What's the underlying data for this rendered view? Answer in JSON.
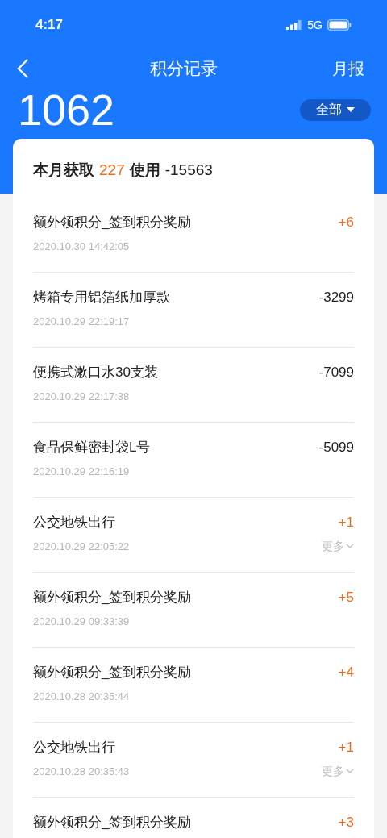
{
  "status_bar": {
    "time": "4:17",
    "network": "5G"
  },
  "nav": {
    "title": "积分记录",
    "action": "月报"
  },
  "balance": "1062",
  "filter": {
    "label": "全部"
  },
  "summary": [
    {
      "kind": "label",
      "text": "本月获取"
    },
    {
      "kind": "gain",
      "text": "227"
    },
    {
      "kind": "label",
      "text": "使用"
    },
    {
      "kind": "value",
      "text": "-15563"
    }
  ],
  "records": [
    {
      "name": "额外领积分_签到积分奖励",
      "date": "2020.10.30 14:42:05",
      "amount": "+6",
      "kind": "gain"
    },
    {
      "name": "烤箱专用铝箔纸加厚款",
      "date": "2020.10.29 22:19:17",
      "amount": "-3299",
      "kind": "spend"
    },
    {
      "name": "便携式漱口水30支装",
      "date": "2020.10.29 22:17:38",
      "amount": "-7099",
      "kind": "spend"
    },
    {
      "name": "食品保鲜密封袋L号",
      "date": "2020.10.29 22:16:19",
      "amount": "-5099",
      "kind": "spend"
    },
    {
      "name": "公交地铁出行",
      "date": "2020.10.29 22:05:22",
      "amount": "+1",
      "kind": "gain",
      "more": "更多"
    },
    {
      "name": "额外领积分_签到积分奖励",
      "date": "2020.10.29 09:33:39",
      "amount": "+5",
      "kind": "gain"
    },
    {
      "name": "额外领积分_签到积分奖励",
      "date": "2020.10.28 20:35:44",
      "amount": "+4",
      "kind": "gain"
    },
    {
      "name": "公交地铁出行",
      "date": "2020.10.28 20:35:43",
      "amount": "+1",
      "kind": "gain",
      "more": "更多"
    },
    {
      "name": "额外领积分_签到积分奖励",
      "amount": "+3",
      "kind": "gain"
    }
  ]
}
